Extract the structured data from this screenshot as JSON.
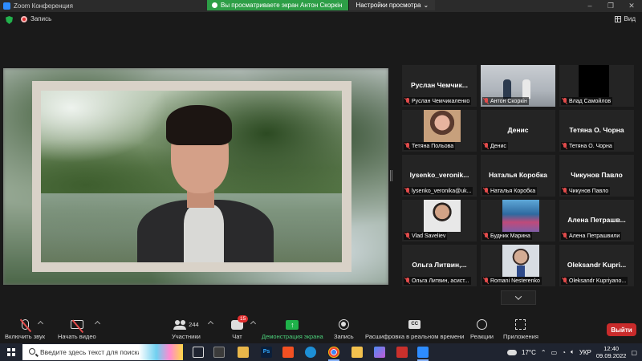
{
  "window": {
    "title": "Zoom Конференция"
  },
  "share_banner": {
    "text": "Вы просматриваете экран Антон Скоркін",
    "options_label": "Настройки просмотра"
  },
  "status": {
    "record_label": "Запись",
    "view_label": "Вид"
  },
  "participants": [
    {
      "display": "Руслан Чемчик...",
      "name": "Руслан Чемчикаленко",
      "photo": ""
    },
    {
      "display": "",
      "name": "Антон Скоркін",
      "photo": "anton"
    },
    {
      "display": "",
      "name": "Влад Самойлов",
      "photo": "vlad"
    },
    {
      "display": "",
      "name": "Тетяна Польова",
      "photo": "tetyana"
    },
    {
      "display": "Денис",
      "name": "Денис",
      "photo": ""
    },
    {
      "display": "Тетяна О. Чорна",
      "name": "Тетяна О. Чорна",
      "photo": ""
    },
    {
      "display": "lysenko_veronik...",
      "name": "lysenko_veronika@uk...",
      "photo": ""
    },
    {
      "display": "Наталья Коробка",
      "name": "Наталья Коробка",
      "photo": ""
    },
    {
      "display": "Чикунов Павло",
      "name": "Чикунов Павло",
      "photo": ""
    },
    {
      "display": "",
      "name": "Vlad Saveliev",
      "photo": "vladsav"
    },
    {
      "display": "",
      "name": "Будник Марина",
      "photo": "budnik"
    },
    {
      "display": "Алена Петрашв...",
      "name": "Алена Петрашвили",
      "photo": ""
    },
    {
      "display": "Ольга Литвин,...",
      "name": "Ольга Литвин, асист...",
      "photo": ""
    },
    {
      "display": "",
      "name": "Romani Nesterenko",
      "photo": "romani"
    },
    {
      "display": "Oleksandr Kupri...",
      "name": "Oleksandr Kupriyano...",
      "photo": ""
    }
  ],
  "toolbar": {
    "unmute": "Включить звук",
    "start_video": "Начать видео",
    "participants_count": "244",
    "participants": "Участники",
    "chat": "Чат",
    "chat_badge": "15",
    "share": "Демонстрация экрана",
    "record": "Запись",
    "captions": "Расшифровка в реальном времени",
    "captions_icon": "CC",
    "reactions": "Реакции",
    "apps": "Приложения",
    "leave": "Выйти"
  },
  "taskbar": {
    "search_placeholder": "Введите здесь текст для поиска",
    "weather": "17°C",
    "lang": "УКР",
    "time": "12:40",
    "date": "09.09.2022"
  },
  "colors": {
    "share_green": "#2d9e46",
    "leave_red": "#c92b2b",
    "muted_red": "#e24b4b",
    "screen_share_icon": "#1fb24a"
  }
}
